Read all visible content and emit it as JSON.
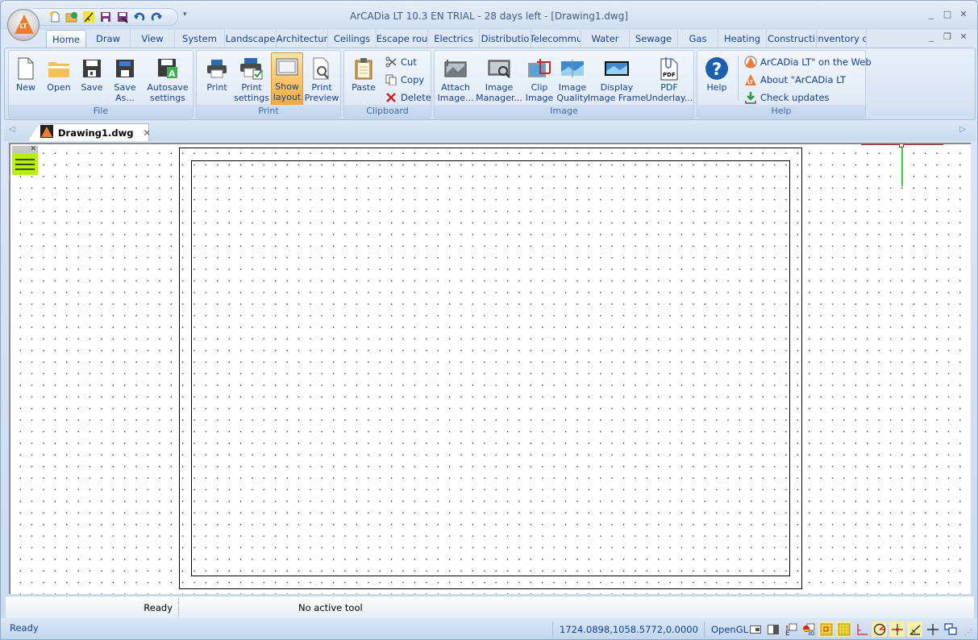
{
  "window": {
    "title": "ArCADia LT 10.3 EN TRIAL - 28 days left - [Drawing1.dwg]",
    "controls": {
      "minimize": "_",
      "maximize": "□",
      "close": "✕"
    },
    "doc_controls": {
      "minimize": "_",
      "restore": "❐",
      "close": "✕"
    },
    "app_orb": "LT"
  },
  "quick_access": {
    "items": [
      "new-icon",
      "open-icon",
      "measure-icon",
      "save-icon",
      "save-as-icon",
      "undo-icon",
      "redo-icon"
    ],
    "more": "▾"
  },
  "ribbon_tabs": [
    {
      "label": "Home",
      "active": true
    },
    {
      "label": "Draw"
    },
    {
      "label": "View"
    },
    {
      "label": "System"
    },
    {
      "label": "Landscape"
    },
    {
      "label": "Architectur"
    },
    {
      "label": "Ceilings"
    },
    {
      "label": "Escape rou"
    },
    {
      "label": "Electrics"
    },
    {
      "label": "Distributio"
    },
    {
      "label": "Telecommu"
    },
    {
      "label": "Water"
    },
    {
      "label": "Sewage"
    },
    {
      "label": "Gas"
    },
    {
      "label": "Heating"
    },
    {
      "label": "Constructi"
    },
    {
      "label": "Inventory c"
    }
  ],
  "ribbon": {
    "file": {
      "label": "File",
      "new": "New",
      "open": "Open",
      "save": "Save",
      "save_as_1": "Save",
      "save_as_2": "As...",
      "autosave_1": "Autosave",
      "autosave_2": "settings"
    },
    "print": {
      "label": "Print",
      "print": "Print",
      "print_settings_1": "Print",
      "print_settings_2": "settings",
      "show_layout_1": "Show",
      "show_layout_2": "layout",
      "show_layout_pressed": true,
      "print_preview_1": "Print",
      "print_preview_2": "Preview"
    },
    "clipboard": {
      "label": "Clipboard",
      "paste": "Paste",
      "cut": "Cut",
      "copy": "Copy",
      "delete": "Delete"
    },
    "image": {
      "label": "Image",
      "attach_1": "Attach",
      "attach_2": "Image...",
      "manager_1": "Image",
      "manager_2": "Manager...",
      "clip_1": "Clip",
      "clip_2": "Image",
      "quality_1": "Image",
      "quality_2": "Quality",
      "frame_1": "Display",
      "frame_2": "Image Frame",
      "pdf_1": "PDF",
      "pdf_2": "Underlay..."
    },
    "help": {
      "label": "Help",
      "help": "Help",
      "web": "ArCADia LT\"  on the Web",
      "about": "About  \"ArCADia LT",
      "updates": "Check updates"
    }
  },
  "document_tabs": [
    {
      "name": "Drawing1.dwg",
      "close": "✕",
      "active": true
    }
  ],
  "canvas": {
    "floating_toolbar_close": "✕"
  },
  "status_bar_top": {
    "left": "Ready",
    "tool": "No active tool"
  },
  "status_bar": {
    "left": "Ready",
    "coordinates": "1724.0898,1058.5772,0.0000",
    "renderer": "OpenGL",
    "toggles": [
      {
        "name": "model-space-toggle",
        "on": false
      },
      {
        "name": "paper-space-toggle",
        "on": false
      },
      {
        "name": "elevation-toggle",
        "on": false
      },
      {
        "name": "3d-view-toggle",
        "on": false
      },
      {
        "name": "snap-toggle",
        "on": true
      },
      {
        "name": "grid-toggle",
        "on": true
      },
      {
        "name": "ortho-toggle",
        "on": false
      },
      {
        "name": "polar-toggle",
        "on": true
      },
      {
        "name": "osnap-toggle",
        "on": true
      },
      {
        "name": "otrack-toggle",
        "on": true
      },
      {
        "name": "crosshair-toggle",
        "on": false
      },
      {
        "name": "window-toggle",
        "on": false
      }
    ]
  },
  "colors": {
    "accent": "#15428b",
    "pressed": "#fbc46c",
    "ucs_x": "#9b2b2b",
    "ucs_y": "#3ccc3c",
    "float_toolbar": "#b8f000"
  }
}
